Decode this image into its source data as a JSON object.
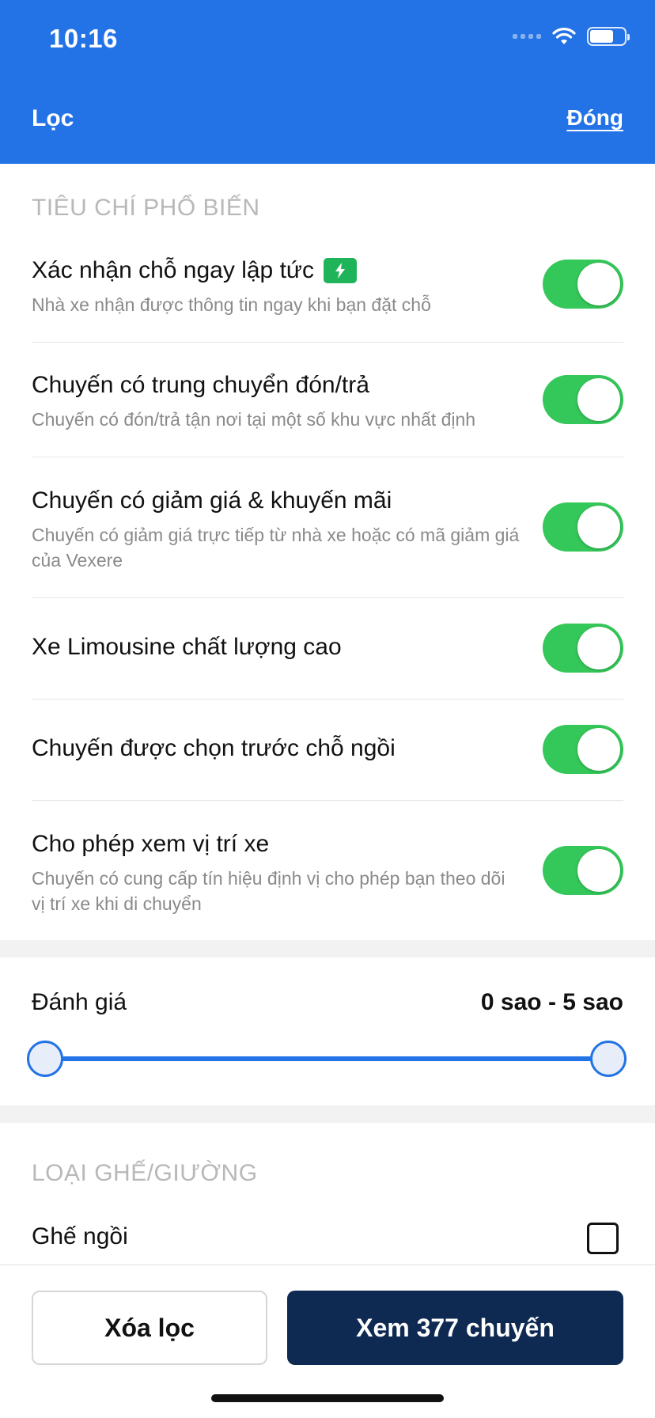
{
  "status_bar": {
    "time": "10:16"
  },
  "header": {
    "title": "Lọc",
    "close_label": "Đóng"
  },
  "popular_section": {
    "title": "TIÊU CHÍ PHỔ BIẾN",
    "items": [
      {
        "title": "Xác nhận chỗ ngay lập tức",
        "description": "Nhà xe nhận được thông tin ngay khi bạn đặt chỗ",
        "badge_icon": "bolt-icon",
        "enabled": true
      },
      {
        "title": "Chuyến có trung chuyển đón/trả",
        "description": "Chuyến có đón/trả tận nơi tại một số khu vực nhất định",
        "enabled": true
      },
      {
        "title": "Chuyến có giảm giá & khuyến mãi",
        "description": "Chuyến có giảm giá trực tiếp từ nhà xe hoặc có mã giảm giá của Vexere",
        "enabled": true
      },
      {
        "title": "Xe Limousine chất lượng cao",
        "description": "",
        "enabled": true
      },
      {
        "title": "Chuyến được chọn trước chỗ ngồi",
        "description": "",
        "enabled": true
      },
      {
        "title": "Cho phép xem vị trí xe",
        "description": "Chuyến có cung cấp tín hiệu định vị cho phép bạn theo dõi vị trí xe khi di chuyển",
        "enabled": true
      }
    ]
  },
  "rating": {
    "label": "Đánh giá",
    "value_text": "0 sao - 5 sao",
    "min": 0,
    "max": 5
  },
  "seat_section": {
    "title": "LOẠI GHẾ/GIƯỜNG",
    "items": [
      {
        "label": "Ghế ngồi",
        "checked": false
      }
    ]
  },
  "footer": {
    "clear_label": "Xóa lọc",
    "view_label": "Xem 377 chuyến"
  },
  "colors": {
    "header": "#2373e6",
    "toggle_on": "#34c759",
    "primary_button": "#0f2a52",
    "badge": "#1fb45a"
  }
}
